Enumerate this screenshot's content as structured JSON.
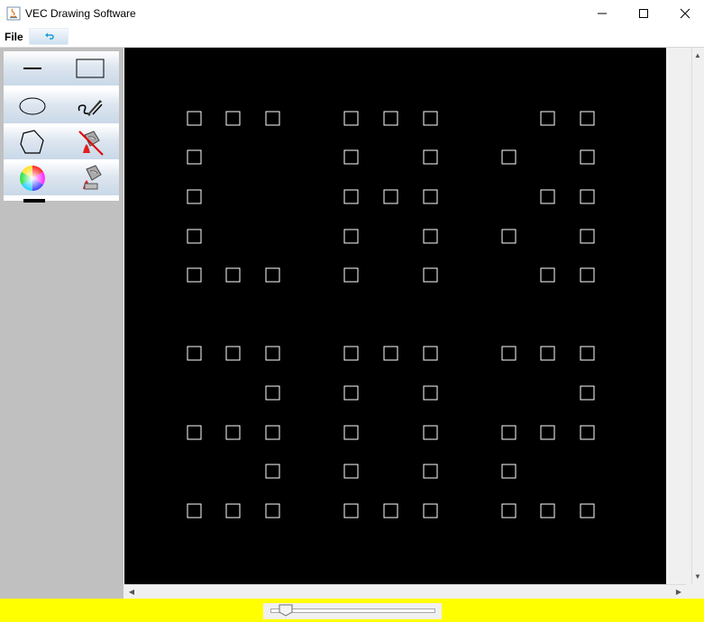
{
  "window": {
    "title": "VEC Drawing Software",
    "controls": [
      "minimize-icon",
      "maximize-icon",
      "close-icon"
    ]
  },
  "menubar": {
    "items": [
      "File"
    ],
    "undo_icon": "undo-icon"
  },
  "tools": [
    {
      "name": "line-tool",
      "icon": "line-icon"
    },
    {
      "name": "rectangle-tool",
      "icon": "rectangle-icon"
    },
    {
      "name": "ellipse-tool",
      "icon": "ellipse-icon"
    },
    {
      "name": "freehand-tool",
      "icon": "pen-icon"
    },
    {
      "name": "polygon-tool",
      "icon": "polygon-icon"
    },
    {
      "name": "no-fill-tool",
      "icon": "no-fill-bucket-icon"
    },
    {
      "name": "color-picker-tool",
      "icon": "color-wheel-icon"
    },
    {
      "name": "fill-tool",
      "icon": "paint-bucket-icon"
    }
  ],
  "current_color": "#000000",
  "canvas": {
    "background": "#000000",
    "shape_stroke": "#ffffff"
  },
  "colors": {
    "status_bar": "#ffff00",
    "canvas": "#000000",
    "side_panel": "#c0c0c0"
  },
  "zoom_slider_value": 0.07
}
